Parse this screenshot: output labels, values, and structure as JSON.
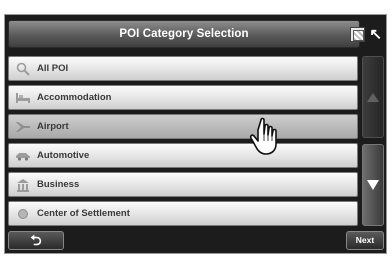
{
  "header": {
    "title": "POI Category Selection",
    "map_icon": "map-view-icon",
    "back_arrow_icon": "arrow-up-left-icon"
  },
  "categories": [
    {
      "label": "All POI",
      "icon": "magnifier-icon",
      "selected": false
    },
    {
      "label": "Accommodation",
      "icon": "bed-icon",
      "selected": false
    },
    {
      "label": "Airport",
      "icon": "airplane-icon",
      "selected": true
    },
    {
      "label": "Automotive",
      "icon": "car-icon",
      "selected": false
    },
    {
      "label": "Business",
      "icon": "building-icon",
      "selected": false
    },
    {
      "label": "Center of Settlement",
      "icon": "circle-icon",
      "selected": false
    }
  ],
  "scrollbar": {
    "up_icon": "triangle-up-icon",
    "down_icon": "triangle-down-icon"
  },
  "footer": {
    "back_symbol": "⮌",
    "next_label": "Next"
  },
  "colors": {
    "frame": "#1c1c1c",
    "row": "#e2e2e2",
    "selected_row": "#b7b7b7",
    "text": "#3a3a3a"
  }
}
